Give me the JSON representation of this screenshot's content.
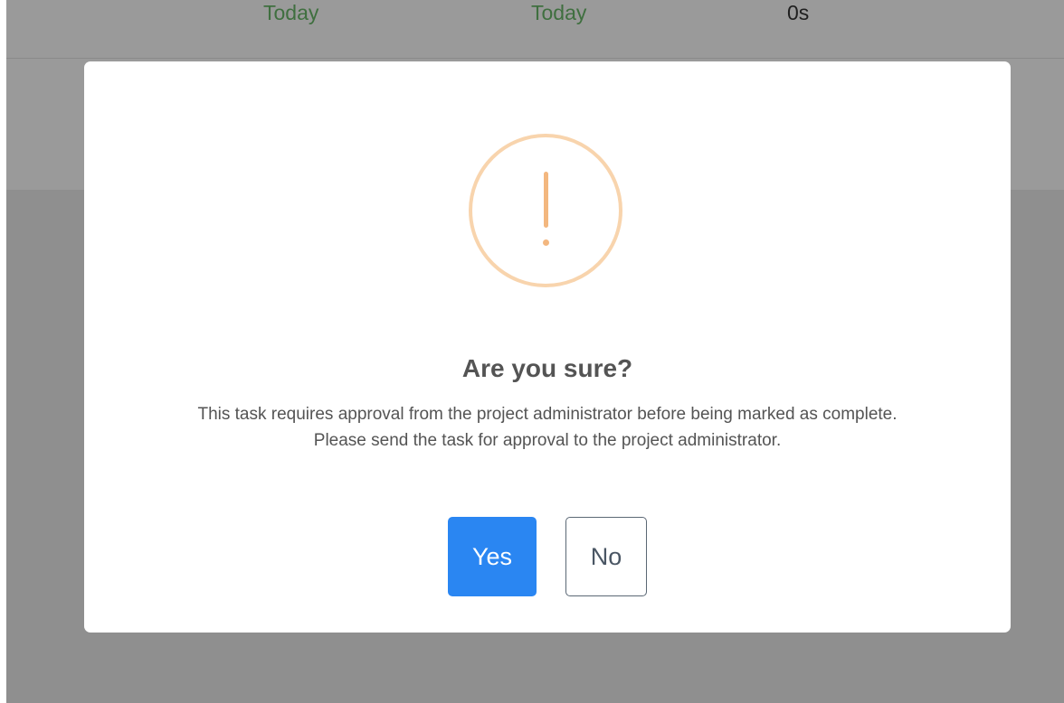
{
  "background_table": {
    "row": {
      "start_date": "Today",
      "due_date": "Today",
      "duration": "0s"
    }
  },
  "dialog": {
    "icon": "exclamation-icon",
    "title": "Are you sure?",
    "message": "This task requires approval from the project administrator before being marked as complete. Please send the task for approval to the project administrator.",
    "confirm_label": "Yes",
    "cancel_label": "No"
  },
  "colors": {
    "confirm_button": "#2a86f2",
    "warning_icon": "#f3b77f",
    "overlay": "#8f8f8f",
    "date_text": "#3f6f3f"
  }
}
